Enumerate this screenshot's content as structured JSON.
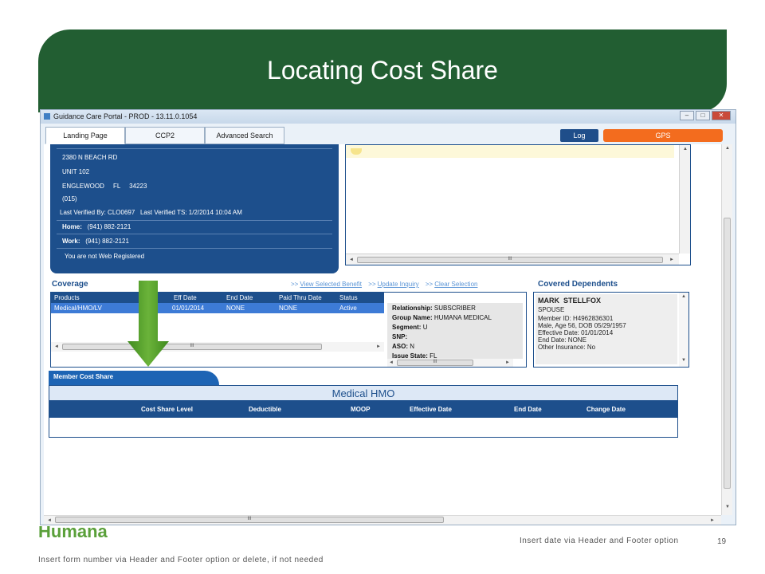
{
  "slide": {
    "title": "Locating Cost Share",
    "logo_text": "Humana",
    "footer_date": "Insert date via Header and Footer option",
    "page_number": "19",
    "footer_form": "Insert form number via Header and Footer option or delete, if not needed"
  },
  "window": {
    "title": "Guidance Care Portal - PROD - 13.11.0.1054",
    "controls": [
      "–",
      "□",
      "✕"
    ]
  },
  "tabs": [
    {
      "label": "Landing Page"
    },
    {
      "label": "CCP2"
    },
    {
      "label": "Advanced Search"
    }
  ],
  "toolbar": {
    "log_label": "Log",
    "gps_label": "GPS"
  },
  "address": {
    "street": "2380 N BEACH RD",
    "unit": "UNIT 102",
    "city_line": "ENGLEWOOD     FL     34223",
    "code": "(015)",
    "last_verified_by_label": "Last Verified By:",
    "last_verified_by": "CLO0697",
    "last_verified_ts_label": "Last Verified TS:",
    "last_verified_ts": "1/2/2014 10:04 AM",
    "home_label": "Home:",
    "home": "(941) 882-2121",
    "work_label": "Work:",
    "work": "(941) 882-2121",
    "web_status": "You are not Web Registered"
  },
  "coverage": {
    "label": "Coverage",
    "links": [
      "View Selected Benefit",
      "Update Inquiry",
      "Clear Selection"
    ],
    "link_prefix": ">>",
    "columns": [
      "Products",
      "Eff Date",
      "End Date",
      "Paid Thru Date",
      "Status"
    ],
    "row": {
      "product": "Medical/HMO/LV",
      "eff": "01/01/2014",
      "end": "NONE",
      "paid": "NONE",
      "status": "Active"
    },
    "details": [
      {
        "label": "Relationship:",
        "value": "SUBSCRIBER"
      },
      {
        "label": "Group Name:",
        "value": "HUMANA MEDICAL"
      },
      {
        "label": "Segment:",
        "value": "U"
      },
      {
        "label": "SNP:",
        "value": ""
      },
      {
        "label": "ASO:",
        "value": "N"
      },
      {
        "label": "Issue State:",
        "value": "FL"
      }
    ],
    "scroll_thumb": "III"
  },
  "dependents": {
    "label": "Covered Dependents",
    "name": "MARK  STELLFOX",
    "relation": "SPOUSE",
    "member_id": "Member ID:  H4962836301",
    "demographics": "Male, Age 56, DOB  05/29/1957",
    "effective": "Effective Date:  01/01/2014",
    "end": "End Date:  NONE",
    "other_ins": "Other Insurance:",
    "other_ins_value": "No"
  },
  "cost_share": {
    "tab_label": "Member Cost Share",
    "plan_title": "Medical HMO",
    "columns": [
      "Cost Share Level",
      "Deductible",
      "MOOP",
      "Effective Date",
      "End Date",
      "Change Date"
    ]
  },
  "colors": {
    "banner": "#225e32",
    "panel_blue": "#1d4f8c",
    "gps": "#f36c1e",
    "arrow": "#4f9a28"
  }
}
